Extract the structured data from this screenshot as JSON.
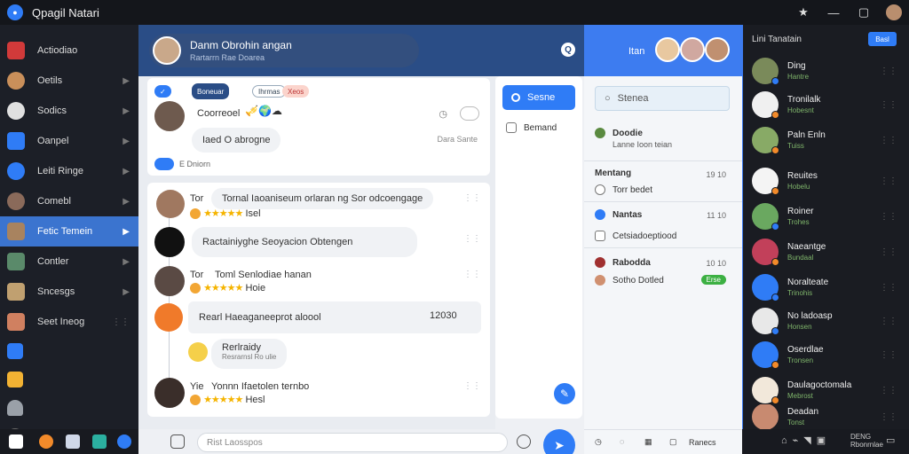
{
  "window": {
    "title": "Qpagil Natari"
  },
  "sidebar": {
    "items": [
      {
        "label": "Actiodiao",
        "color": "#d13a3a"
      },
      {
        "label": "Oetils",
        "color": "#c98f5a"
      },
      {
        "label": "Sodics",
        "color": "#e0e0e0"
      },
      {
        "label": "Oanpel",
        "color": "#2f7cf6"
      },
      {
        "label": "Leiti Ringe",
        "color": "#2f7cf6"
      },
      {
        "label": "Comebl",
        "color": "#8a6a5a"
      },
      {
        "label": "Fetic Temein",
        "color": "#a8835f"
      },
      {
        "label": "Contler",
        "color": "#5a8a6a"
      },
      {
        "label": "Sncesgs",
        "color": "#c0a070"
      },
      {
        "label": "Seet Ineog",
        "color": "#d08060"
      }
    ]
  },
  "chat_header": {
    "name": "Danm Obrohin angan",
    "subtitle": "Rartarrn Rae Doarea"
  },
  "feed": {
    "top_card": {
      "tags": [
        "Boneuar",
        "Ihrmas",
        "Xeos"
      ],
      "line1": "Coorreoel",
      "line2": "Iaed O abrogne",
      "time": "Dara Sante",
      "footer": "E Dniorn"
    },
    "posts": [
      {
        "prefix": "Tor",
        "text": "Tornal Iaoaniseum orlaran ng Sor odcoengage",
        "meta": "Isel"
      },
      {
        "text": "Ractainiyghe Seoyacion Obtengen"
      },
      {
        "prefix": "Tor",
        "text": "Toml Senlodiae hanan",
        "meta": "Hoie"
      },
      {
        "text": "Rearl Haeaganeeprot aloool",
        "count": "12030"
      },
      {
        "text": "Rerlraidy",
        "sub": "Resrarnsl Ro ulie"
      },
      {
        "prefix": "Yie",
        "text": "Yonnn Ifaetolen ternbo",
        "meta": "Hesl"
      }
    ]
  },
  "mid_panel": {
    "search_label": "Sesne",
    "item_label": "Bemand"
  },
  "right_panel": {
    "header_title": "Itan",
    "search_placeholder": "Stenea",
    "sections": [
      {
        "title": "Doodie",
        "sub": "Lanne Ioon teian"
      },
      {
        "title": "Mentang",
        "time": "19 10",
        "sub": "Torr bedet"
      },
      {
        "title": "Nantas",
        "time": "11 10",
        "sub": "Cetsiadoeptiood"
      },
      {
        "title": "Rabodda",
        "time": "10 10",
        "sub": "Sotho Dotled",
        "badge": "Erse"
      }
    ],
    "footer_label": "Ranecs"
  },
  "contacts": {
    "header": "Lini Tanatain",
    "header_btn": "Basl",
    "list": [
      {
        "name": "Ding",
        "status": "Hantre",
        "color": "#7a8a5a"
      },
      {
        "name": "Tronilalk",
        "status": "Hobesnt",
        "color": "#f0f0f0"
      },
      {
        "name": "Paln Enln",
        "status": "Tuiss",
        "color": "#88aa66"
      },
      {
        "name": "Reuites",
        "status": "Hobelu",
        "color": "#f4f4f4"
      },
      {
        "name": "Roiner",
        "status": "Trohes",
        "color": "#6aa860"
      },
      {
        "name": "Naeantge",
        "status": "Bundaal",
        "color": "#c2405a"
      },
      {
        "name": "Noralteate",
        "status": "Trinohis",
        "color": "#2f7cf6"
      },
      {
        "name": "No ladoasp",
        "status": "Honsen",
        "color": "#e8e8e8"
      },
      {
        "name": "Oserdlae",
        "status": "Tronsen",
        "color": "#2f7cf6"
      },
      {
        "name": "Daulagoctomala",
        "status": "Mebrost",
        "color": "#f2e8da"
      },
      {
        "name": "Deadan",
        "status": "Tonst",
        "color": "#c88a70"
      }
    ]
  },
  "composer": {
    "placeholder": "Rist Laosspos"
  },
  "taskbar": {
    "tray_label": "DENG",
    "tray_sub": "Rbonrnlae"
  }
}
